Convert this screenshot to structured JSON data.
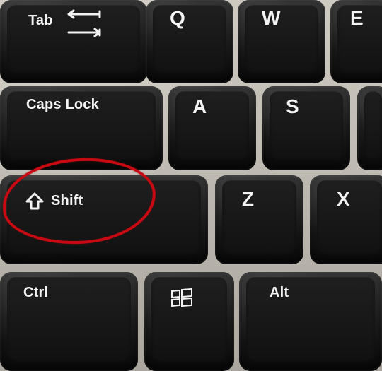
{
  "keys": {
    "tab": {
      "label": "Tab",
      "icon": "tab-arrows-icon"
    },
    "q": {
      "label": "Q"
    },
    "w": {
      "label": "W"
    },
    "e": {
      "label": "E"
    },
    "caps_lock": {
      "label": "Caps Lock"
    },
    "a": {
      "label": "A"
    },
    "s": {
      "label": "S"
    },
    "shift": {
      "label": "Shift",
      "icon": "shift-arrow-icon"
    },
    "z": {
      "label": "Z"
    },
    "x": {
      "label": "X"
    },
    "ctrl": {
      "label": "Ctrl"
    },
    "windows": {
      "label": "",
      "icon": "windows-logo-icon"
    },
    "alt": {
      "label": "Alt"
    }
  },
  "highlight": {
    "target": "Shift",
    "color": "#c90a12"
  }
}
